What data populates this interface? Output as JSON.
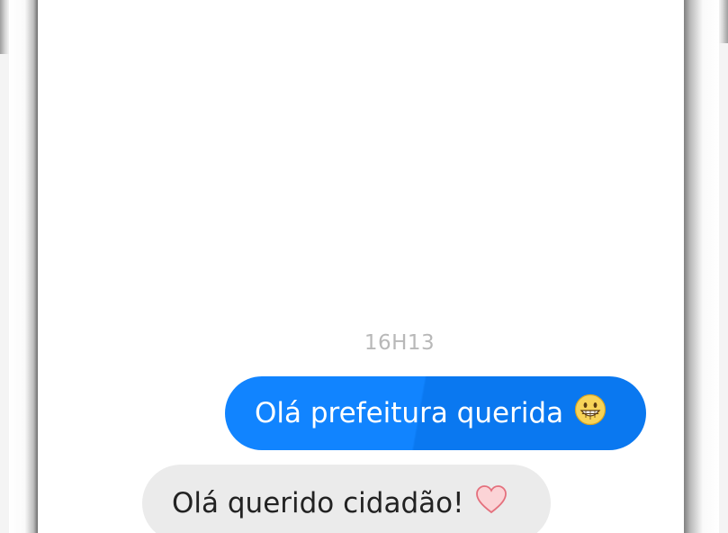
{
  "conversation": {
    "timestamp": "16H13",
    "messages": [
      {
        "direction": "sent",
        "text": "Olá prefeitura querida",
        "emoji": "grinning-face-icon"
      },
      {
        "direction": "received",
        "text": "Olá querido cidadão!",
        "emoji": "heart-icon"
      }
    ]
  },
  "colors": {
    "sent_bubble": "#1184ff",
    "received_bubble": "#ebebeb",
    "timestamp_text": "#b8b8b8"
  }
}
